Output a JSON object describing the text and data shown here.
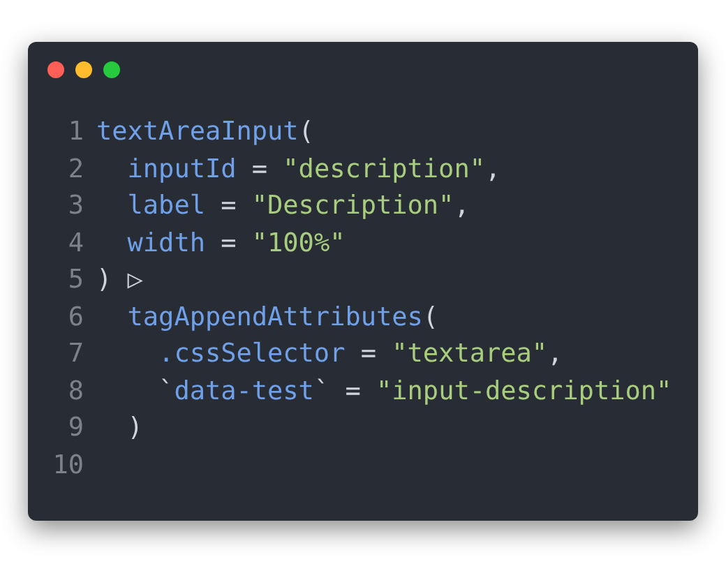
{
  "window": {
    "controls": [
      {
        "color": "#ff5f56"
      },
      {
        "color": "#ffbd2e"
      },
      {
        "color": "#27c93f"
      }
    ]
  },
  "code": {
    "lines": [
      {
        "number": "1",
        "tokens": [
          {
            "kind": "name",
            "text": "textAreaInput"
          },
          {
            "kind": "punct",
            "text": "("
          }
        ]
      },
      {
        "number": "2",
        "tokens": [
          {
            "kind": "name",
            "text": "  inputId"
          },
          {
            "kind": "punct",
            "text": " = "
          },
          {
            "kind": "string",
            "text": "\"description\""
          },
          {
            "kind": "punct",
            "text": ","
          }
        ]
      },
      {
        "number": "3",
        "tokens": [
          {
            "kind": "name",
            "text": "  label"
          },
          {
            "kind": "punct",
            "text": " = "
          },
          {
            "kind": "string",
            "text": "\"Description\""
          },
          {
            "kind": "punct",
            "text": ","
          }
        ]
      },
      {
        "number": "4",
        "tokens": [
          {
            "kind": "name",
            "text": "  width"
          },
          {
            "kind": "punct",
            "text": " = "
          },
          {
            "kind": "string",
            "text": "\"100%\""
          }
        ]
      },
      {
        "number": "5",
        "tokens": [
          {
            "kind": "punct",
            "text": ") ▷"
          }
        ]
      },
      {
        "number": "6",
        "tokens": [
          {
            "kind": "name",
            "text": "  tagAppendAttributes"
          },
          {
            "kind": "punct",
            "text": "("
          }
        ]
      },
      {
        "number": "7",
        "tokens": [
          {
            "kind": "name",
            "text": "    .cssSelector"
          },
          {
            "kind": "punct",
            "text": " = "
          },
          {
            "kind": "string",
            "text": "\"textarea\""
          },
          {
            "kind": "punct",
            "text": ","
          }
        ]
      },
      {
        "number": "8",
        "tokens": [
          {
            "kind": "punct",
            "text": "    `"
          },
          {
            "kind": "name",
            "text": "data-test"
          },
          {
            "kind": "punct",
            "text": "` = "
          },
          {
            "kind": "string",
            "text": "\"input-description\""
          }
        ]
      },
      {
        "number": "9",
        "tokens": [
          {
            "kind": "punct",
            "text": "  )"
          }
        ]
      },
      {
        "number": "10"
      }
    ]
  }
}
